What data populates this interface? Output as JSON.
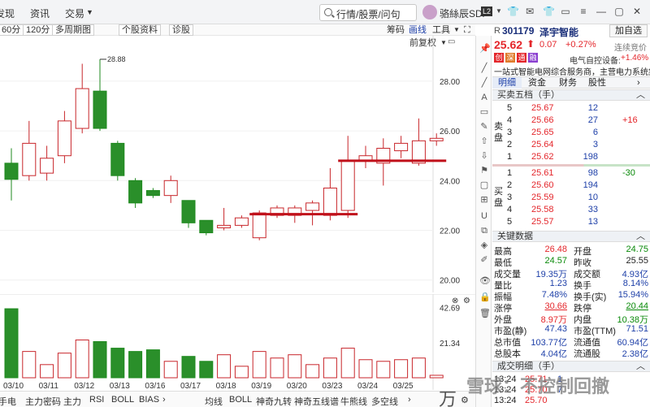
{
  "menu": {
    "items": [
      "发现",
      "资讯",
      "交易"
    ]
  },
  "search": {
    "placeholder": "行情/股票/问句"
  },
  "user": {
    "name": "骆絲辰SDi"
  },
  "toolbar": {
    "buttons": [
      "60分",
      "120分",
      "多周期图",
      "个股资料",
      "诊股"
    ],
    "right_links": [
      "筹码",
      "画线",
      "工具"
    ],
    "adjust": "前复权"
  },
  "chart_data": {
    "type": "candlestick",
    "ylim": [
      19.5,
      29.5
    ],
    "yticks": [
      "28.00",
      "26.00",
      "24.00",
      "22.00",
      "20.00"
    ],
    "ytick_values": [
      28,
      26,
      24,
      22,
      20
    ],
    "high_marker": "28.88",
    "candles": [
      {
        "o": 24.7,
        "c": 24.05,
        "h": 25.3,
        "l": 23.2,
        "v": 42.0
      },
      {
        "o": 24.2,
        "c": 25.5,
        "h": 26.4,
        "l": 24.0,
        "v": 16.0
      },
      {
        "o": 24.3,
        "c": 24.9,
        "h": 25.4,
        "l": 24.0,
        "v": 8.0
      },
      {
        "o": 25.0,
        "c": 26.4,
        "h": 26.8,
        "l": 24.7,
        "v": 15.0
      },
      {
        "o": 26.1,
        "c": 27.7,
        "h": 28.7,
        "l": 25.9,
        "v": 23.0
      },
      {
        "o": 27.6,
        "c": 26.1,
        "h": 28.88,
        "l": 26.0,
        "v": 22.0
      },
      {
        "o": 25.5,
        "c": 24.2,
        "h": 25.6,
        "l": 24.0,
        "v": 18.0
      },
      {
        "o": 24.0,
        "c": 23.1,
        "h": 24.1,
        "l": 22.9,
        "v": 16.0
      },
      {
        "o": 23.6,
        "c": 23.4,
        "h": 23.7,
        "l": 23.3,
        "v": 17.0
      },
      {
        "o": 23.4,
        "c": 24.0,
        "h": 24.2,
        "l": 23.1,
        "v": 10.0
      },
      {
        "o": 23.2,
        "c": 22.3,
        "h": 23.2,
        "l": 22.1,
        "v": 13.0
      },
      {
        "o": 22.4,
        "c": 21.9,
        "h": 22.4,
        "l": 21.8,
        "v": 10.0
      },
      {
        "o": 22.1,
        "c": 22.2,
        "h": 22.9,
        "l": 22.0,
        "v": 14.0
      },
      {
        "o": 22.2,
        "c": 22.5,
        "h": 22.6,
        "l": 22.1,
        "v": 7.0
      },
      {
        "o": 21.7,
        "c": 22.7,
        "h": 22.8,
        "l": 21.6,
        "v": 16.0
      },
      {
        "o": 22.6,
        "c": 22.9,
        "h": 23.0,
        "l": 22.5,
        "v": 12.0
      },
      {
        "o": 22.6,
        "c": 22.9,
        "h": 23.0,
        "l": 22.3,
        "v": 14.0
      },
      {
        "o": 22.8,
        "c": 23.1,
        "h": 23.2,
        "l": 22.2,
        "v": 8.0
      },
      {
        "o": 22.6,
        "c": 23.7,
        "h": 24.5,
        "l": 22.4,
        "v": 12.0
      },
      {
        "o": 22.8,
        "c": 24.8,
        "h": 25.8,
        "l": 22.5,
        "v": 18.0
      },
      {
        "o": 24.8,
        "c": 25.0,
        "h": 25.4,
        "l": 24.5,
        "v": 11.0
      },
      {
        "o": 24.7,
        "c": 25.3,
        "h": 25.7,
        "l": 23.8,
        "v": 10.0
      },
      {
        "o": 25.2,
        "c": 25.5,
        "h": 25.8,
        "l": 24.9,
        "v": 11.0
      },
      {
        "o": 24.7,
        "c": 25.6,
        "h": 26.5,
        "l": 24.6,
        "v": 12.0
      },
      {
        "o": 25.6,
        "c": 25.7,
        "h": 25.9,
        "l": 25.4,
        "v": 1.5
      }
    ],
    "support_lines": [
      {
        "y": 24.8,
        "from": 19,
        "to": 24
      },
      {
        "y": 22.65,
        "from": 14,
        "to": 19
      }
    ],
    "xticks": [
      "03/10",
      "03/11",
      "03/12",
      "03/13",
      "03/16",
      "03/17",
      "03/18",
      "03/19",
      "03/20",
      "03/23",
      "03/24",
      "03/25"
    ],
    "xtick_indices": [
      0,
      2,
      4,
      6,
      8,
      10,
      12,
      14,
      16,
      18,
      20,
      22
    ],
    "volume_ylim": [
      0,
      44
    ],
    "volume_ticks": [
      "42.69",
      "21.34"
    ]
  },
  "bottom_tabs": [
    "手电",
    "主力密码",
    "主力",
    "RSI",
    "BOLL",
    "BIAS",
    "均线",
    "BOLL",
    "神奇九转",
    "神奇五线谱",
    "牛熊线",
    "多空线"
  ],
  "quote": {
    "code": "301179",
    "name": "泽宇智能",
    "price": "25.62",
    "change": "0.07",
    "change_pct": "+0.27%",
    "btn_watch": "加自选",
    "streak": "连续竞价",
    "tags": [
      "创",
      "深",
      "通",
      "融"
    ],
    "sector_label": "电气自控设备:",
    "sector_change": "+1.46%",
    "desc": "一站式智能电网综合服务商，主营电力系统集..."
  },
  "rtabs": [
    "明细",
    "资金",
    "财务",
    "股性"
  ],
  "orderbook": {
    "title": "买卖五档（手）",
    "sell_label": "卖盘",
    "buy_label": "买盘",
    "sells": [
      {
        "lvl": "5",
        "price": "25.67",
        "vol": "12",
        "chg": ""
      },
      {
        "lvl": "4",
        "price": "25.66",
        "vol": "27",
        "chg": "+16"
      },
      {
        "lvl": "3",
        "price": "25.65",
        "vol": "6",
        "chg": ""
      },
      {
        "lvl": "2",
        "price": "25.64",
        "vol": "3",
        "chg": ""
      },
      {
        "lvl": "1",
        "price": "25.62",
        "vol": "198",
        "chg": ""
      }
    ],
    "buys": [
      {
        "lvl": "1",
        "price": "25.61",
        "vol": "98",
        "chg": "-30"
      },
      {
        "lvl": "2",
        "price": "25.60",
        "vol": "194",
        "chg": ""
      },
      {
        "lvl": "3",
        "price": "25.59",
        "vol": "10",
        "chg": ""
      },
      {
        "lvl": "4",
        "price": "25.58",
        "vol": "33",
        "chg": ""
      },
      {
        "lvl": "5",
        "price": "25.57",
        "vol": "13",
        "chg": ""
      }
    ]
  },
  "key_data": {
    "title": "关键数据",
    "rows": [
      {
        "l1": "最高",
        "v1": "26.48",
        "c1": "red",
        "l2": "开盘",
        "v2": "24.75",
        "c2": "green"
      },
      {
        "l1": "最低",
        "v1": "24.57",
        "c1": "green",
        "l2": "昨收",
        "v2": "25.55",
        "c2": ""
      },
      {
        "l1": "成交量",
        "v1": "19.35万",
        "c1": "blue",
        "l2": "成交额",
        "v2": "4.93亿",
        "c2": "blue"
      },
      {
        "l1": "量比",
        "v1": "1.23",
        "c1": "blue",
        "l2": "换手",
        "v2": "8.14%",
        "c2": "blue"
      },
      {
        "l1": "振幅",
        "v1": "7.48%",
        "c1": "blue",
        "l2": "换手(实)",
        "v2": "15.94%",
        "c2": "blue"
      },
      {
        "l1": "涨停",
        "v1": "30.66",
        "c1": "red",
        "l2": "跌停",
        "v2": "20.44",
        "c2": "green"
      },
      {
        "l1": "外盘",
        "v1": "8.97万",
        "c1": "red",
        "l2": "内盘",
        "v2": "10.38万",
        "c2": "green"
      },
      {
        "l1": "市盈(静)",
        "v1": "47.43",
        "c1": "blue",
        "l2": "市盈(TTM)",
        "v2": "71.51",
        "c2": "blue"
      },
      {
        "l1": "总市值",
        "v1": "103.77亿",
        "c1": "blue",
        "l2": "流通值",
        "v2": "60.94亿",
        "c2": "blue"
      },
      {
        "l1": "总股本",
        "v1": "4.04亿",
        "c1": "blue",
        "l2": "流通股",
        "v2": "2.38亿",
        "c2": "blue"
      }
    ]
  },
  "trades": {
    "title": "成交明细（手）",
    "rows": [
      {
        "time": "13:24",
        "price": "25.71",
        "vol": "1"
      },
      {
        "time": "13:24",
        "price": "25.70",
        "vol": "7"
      },
      {
        "time": "13:24",
        "price": "25.70",
        "vol": ""
      }
    ]
  },
  "watermark": "雪球：不控制回撤"
}
